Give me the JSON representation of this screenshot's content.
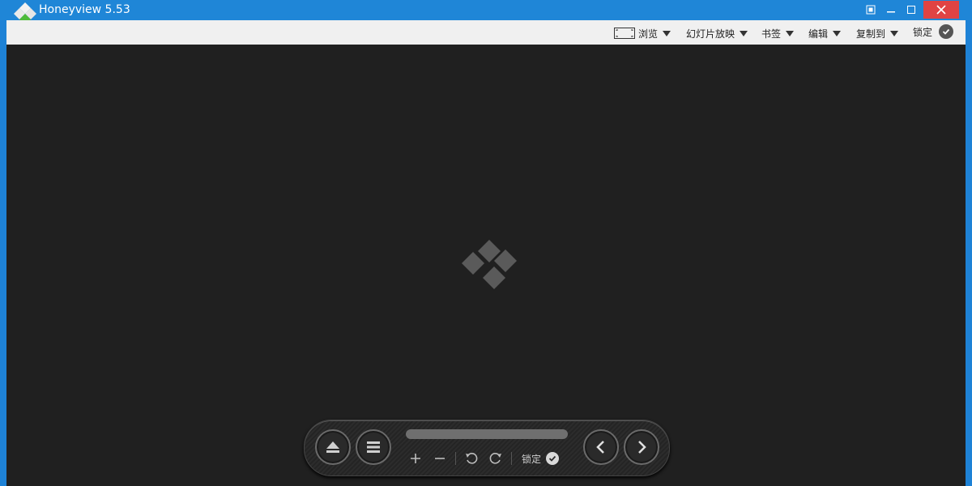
{
  "window": {
    "title": "Honeyview 5.53"
  },
  "toolbar": {
    "browse_label": "浏览",
    "slideshow_label": "幻灯片放映",
    "bookmark_label": "书签",
    "edit_label": "编辑",
    "copy_to_label": "复制到",
    "lock_label": "锁定"
  },
  "controls": {
    "lock_label": "锁定",
    "icons": [
      "eject-icon",
      "menu-icon",
      "zoom-in-icon",
      "zoom-out-icon",
      "rotate-left-icon",
      "rotate-right-icon",
      "check-icon",
      "previous-icon",
      "next-icon"
    ]
  },
  "colors": {
    "titlebar": "#1f86d7",
    "viewer": "#202020",
    "close_hover": "#e04343"
  }
}
